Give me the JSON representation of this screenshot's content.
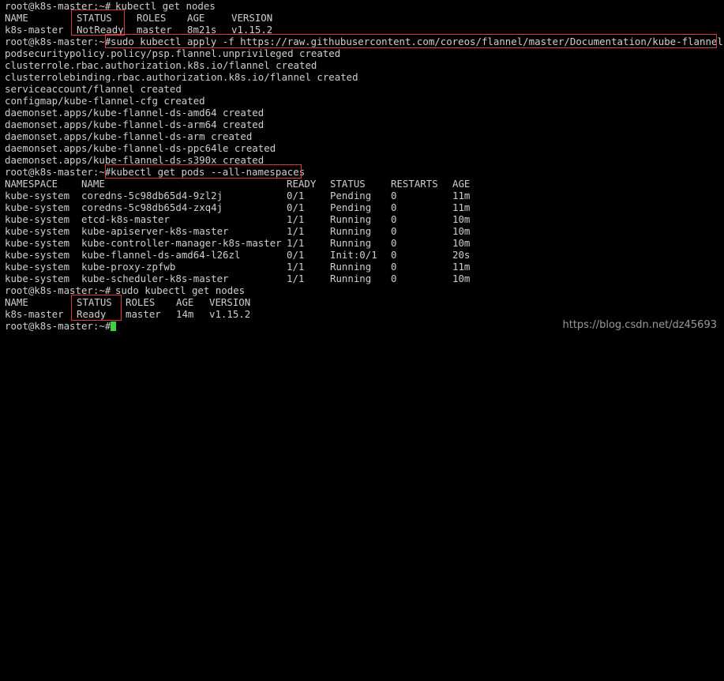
{
  "terminal": {
    "prompt": "root@k8s-master:~#",
    "cmd_get_nodes_1": "kubectl get nodes",
    "nodes1": {
      "headers": [
        "NAME",
        "STATUS",
        "ROLES",
        "AGE",
        "VERSION"
      ],
      "row": [
        "k8s-master",
        "NotReady",
        "master",
        "8m21s",
        "v1.15.2"
      ]
    },
    "cmd_apply": "sudo kubectl apply -f https://raw.githubusercontent.com/coreos/flannel/master/Documentation/kube-flannel.yml",
    "apply_output": [
      "podsecuritypolicy.policy/psp.flannel.unprivileged created",
      "clusterrole.rbac.authorization.k8s.io/flannel created",
      "clusterrolebinding.rbac.authorization.k8s.io/flannel created",
      "serviceaccount/flannel created",
      "configmap/kube-flannel-cfg created",
      "daemonset.apps/kube-flannel-ds-amd64 created",
      "daemonset.apps/kube-flannel-ds-arm64 created",
      "daemonset.apps/kube-flannel-ds-arm created",
      "daemonset.apps/kube-flannel-ds-ppc64le created",
      "daemonset.apps/kube-flannel-ds-s390x created"
    ],
    "cmd_get_pods": "kubectl get pods --all-namespaces",
    "pods": {
      "headers": [
        "NAMESPACE",
        "NAME",
        "READY",
        "STATUS",
        "RESTARTS",
        "AGE"
      ],
      "rows": [
        [
          "kube-system",
          "coredns-5c98db65d4-9zl2j",
          "0/1",
          "Pending",
          "0",
          "11m"
        ],
        [
          "kube-system",
          "coredns-5c98db65d4-zxq4j",
          "0/1",
          "Pending",
          "0",
          "11m"
        ],
        [
          "kube-system",
          "etcd-k8s-master",
          "1/1",
          "Running",
          "0",
          "10m"
        ],
        [
          "kube-system",
          "kube-apiserver-k8s-master",
          "1/1",
          "Running",
          "0",
          "10m"
        ],
        [
          "kube-system",
          "kube-controller-manager-k8s-master",
          "1/1",
          "Running",
          "0",
          "10m"
        ],
        [
          "kube-system",
          "kube-flannel-ds-amd64-l26zl",
          "0/1",
          "Init:0/1",
          "0",
          "20s"
        ],
        [
          "kube-system",
          "kube-proxy-zpfwb",
          "1/1",
          "Running",
          "0",
          "11m"
        ],
        [
          "kube-system",
          "kube-scheduler-k8s-master",
          "1/1",
          "Running",
          "0",
          "10m"
        ]
      ]
    },
    "cmd_get_nodes_2": "sudo kubectl get nodes",
    "nodes2": {
      "headers": [
        "NAME",
        "STATUS",
        "ROLES",
        "AGE",
        "VERSION"
      ],
      "row": [
        "k8s-master",
        "Ready",
        "master",
        "14m",
        "v1.15.2"
      ]
    }
  },
  "watermark": "https://blog.csdn.net/dz45693",
  "colors": {
    "background": "#000000",
    "text": "#cfcfcf",
    "highlight_box": "#d93a3a",
    "cursor": "#3cd43c"
  }
}
